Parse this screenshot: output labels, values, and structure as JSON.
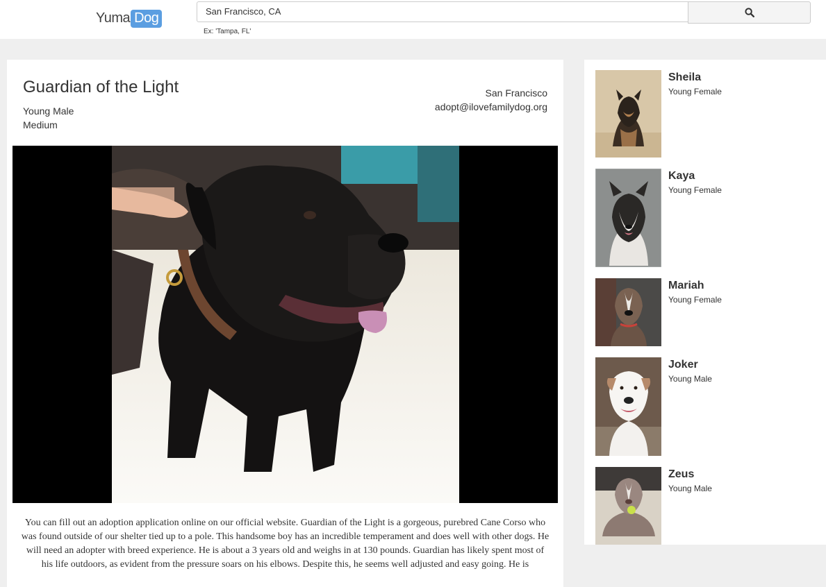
{
  "header": {
    "logo_part1": "Yuma",
    "logo_part2": "Dog",
    "search_value": "San Francisco, CA",
    "search_hint": "Ex: 'Tampa, FL'",
    "search_icon": "search-icon"
  },
  "dog": {
    "name": "Guardian of the Light",
    "age_sex": "Young Male",
    "size": "Medium",
    "location": "San Francisco",
    "email": "adopt@ilovefamilydog.org",
    "description": "You can fill out an adoption application online on our official website. Guardian of the Light is a gorgeous, purebred Cane Corso who was found outside of our shelter tied up to a pole. This handsome boy has an incredible temperament and does well with other dogs. He will need an adopter with breed experience. He is about a 3 years old and weighs in at 130 pounds. Guardian has likely spent most of his life outdoors, as evident from the pressure soars on his elbows. Despite this, he seems well adjusted and easy going. He is"
  },
  "sidebar": {
    "dogs": [
      {
        "name": "Sheila",
        "info": "Young Female"
      },
      {
        "name": "Kaya",
        "info": "Young Female"
      },
      {
        "name": "Mariah",
        "info": "Young Female"
      },
      {
        "name": "Joker",
        "info": "Young Male"
      },
      {
        "name": "Zeus",
        "info": "Young Male"
      }
    ]
  },
  "colors": {
    "brand_blue": "#5b9ee1",
    "page_background": "#efefef"
  }
}
